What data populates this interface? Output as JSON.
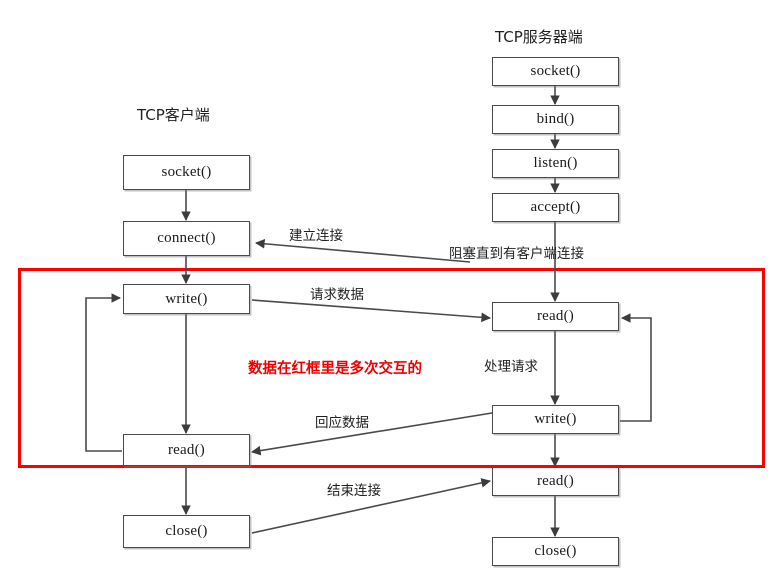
{
  "diagram": {
    "title_client": "TCP客户端",
    "title_server": "TCP服务器端",
    "red_note": "数据在红框里是多次交互的"
  },
  "client": {
    "nodes": [
      {
        "id": "c-socket",
        "label": "socket()"
      },
      {
        "id": "c-connect",
        "label": "connect()"
      },
      {
        "id": "c-write",
        "label": "write()"
      },
      {
        "id": "c-read",
        "label": "read()"
      },
      {
        "id": "c-close",
        "label": "close()"
      }
    ]
  },
  "server": {
    "nodes": [
      {
        "id": "s-socket",
        "label": "socket()"
      },
      {
        "id": "s-bind",
        "label": "bind()"
      },
      {
        "id": "s-listen",
        "label": "listen()"
      },
      {
        "id": "s-accept",
        "label": "accept()"
      },
      {
        "id": "s-read",
        "label": "read()"
      },
      {
        "id": "s-write",
        "label": "write()"
      },
      {
        "id": "s-read2",
        "label": "read()"
      },
      {
        "id": "s-close",
        "label": "close()"
      }
    ]
  },
  "labels": {
    "establish": "建立连接",
    "block_until_client": "阻塞直到有客户端连接",
    "request_data": "请求数据",
    "handle_request": "处理请求",
    "response_data": "回应数据",
    "end_connection": "结束连接"
  },
  "colors": {
    "red_box": "#ff0000",
    "red_note": "#ee0000",
    "line": "#4a4a4a",
    "background": "#ffffff"
  }
}
